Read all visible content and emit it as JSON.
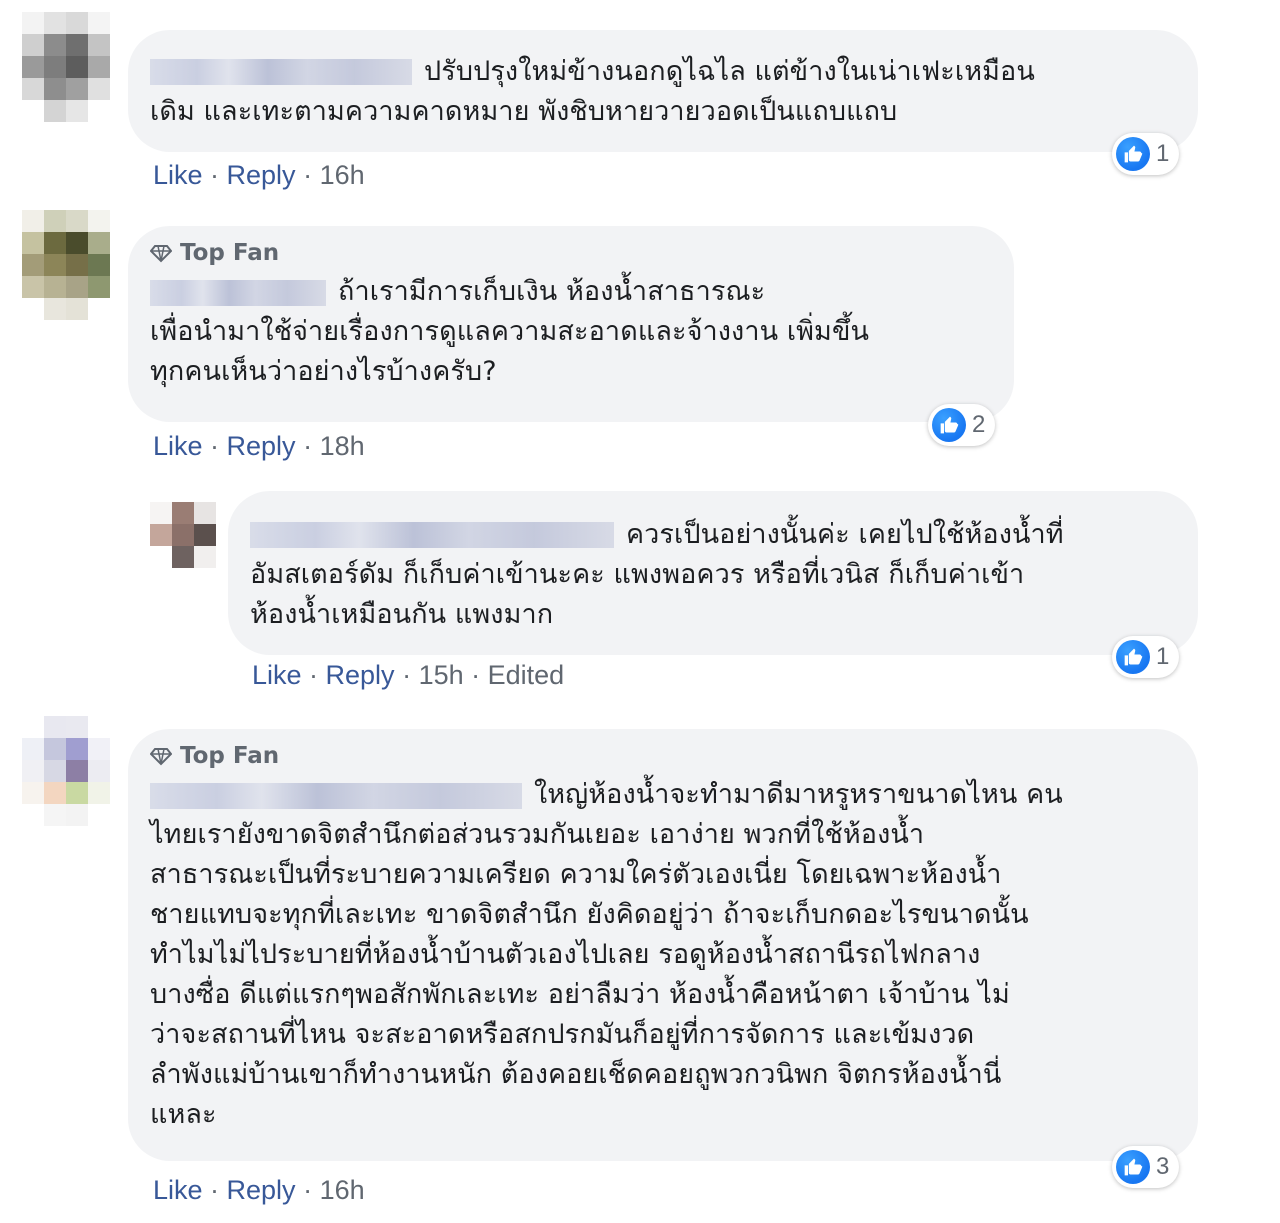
{
  "colors": {
    "link": "#385898",
    "meta": "#606770",
    "bubble": "#f2f3f5",
    "like": "#1877f2"
  },
  "comments": [
    {
      "text_line1": "ปรับปรุงใหม่ข้างนอกดูไฉไล แต่ข้างในเน่าเฟะเหมือน",
      "text_line2": "เดิม และเทะตามความคาดหมาย พังชิบหายวายวอดเป็นแถบแถบ",
      "like": "Like",
      "reply": "Reply",
      "time": "16h",
      "reactions": "1"
    },
    {
      "badge": "Top Fan",
      "text_line1": "ถ้าเรามีการเก็บเงิน ห้องน้ำสาธารณะ",
      "text_line2": "เพื่อนำมาใช้จ่ายเรื่องการดูแลความสะอาดและจ้างงาน เพิ่มขึ้น",
      "text_line3": "ทุกคนเห็นว่าอย่างไรบ้างครับ?",
      "like": "Like",
      "reply": "Reply",
      "time": "18h",
      "reactions": "2"
    },
    {
      "text_line1": "ควรเป็นอย่างนั้นค่ะ เคยไปใช้ห้องน้ำที่",
      "text_line2": "อัมสเตอร์ดัม ก็เก็บค่าเข้านะคะ แพงพอควร หรือที่เวนิส ก็เก็บค่าเข้า",
      "text_line3": "ห้องน้ำเหมือนกัน แพงมาก",
      "like": "Like",
      "reply": "Reply",
      "time": "15h",
      "edited": "Edited",
      "reactions": "1"
    },
    {
      "badge": "Top Fan",
      "lines": [
        "ใหญ่ห้องน้ำจะทำมาดีมาหรูหราขนาดไหน คน",
        "ไทยเรายังขาดจิตสำนึกต่อส่วนรวมกันเยอะ เอาง่าย พวกที่ใช้ห้องน้ำ",
        "สาธารณะเป็นที่ระบายความเครียด ความใคร่ตัวเองเนี่ย โดยเฉพาะห้องน้ำ",
        "ชายแทบจะทุกที่เละเทะ ขาดจิตสำนึก ยังคิดอยู่ว่า ถ้าจะเก็บกดอะไรขนาดนั้น",
        "ทำไมไม่ไประบายที่ห้องน้ำบ้านตัวเองไปเลย รอดูห้องน้ำสถานีรถไฟกลาง",
        "บางซื่อ ดีแต่แรกๆพอสักพักเละเทะ อย่าลืมว่า ห้องน้ำคือหน้าตา เจ้าบ้าน ไม่",
        "ว่าจะสถานที่ไหน จะสะอาดหรือสกปรกมันก็อยู่ที่การจัดการ และเข้มงวด",
        "ลำพังแม่บ้านเขาก็ทำงานหนัก ต้องคอยเช็ดคอยถูพวกวนิพก จิตกรห้องน้ำนี่",
        "แหละ"
      ],
      "like": "Like",
      "reply": "Reply",
      "time": "16h",
      "reactions": "3"
    }
  ]
}
